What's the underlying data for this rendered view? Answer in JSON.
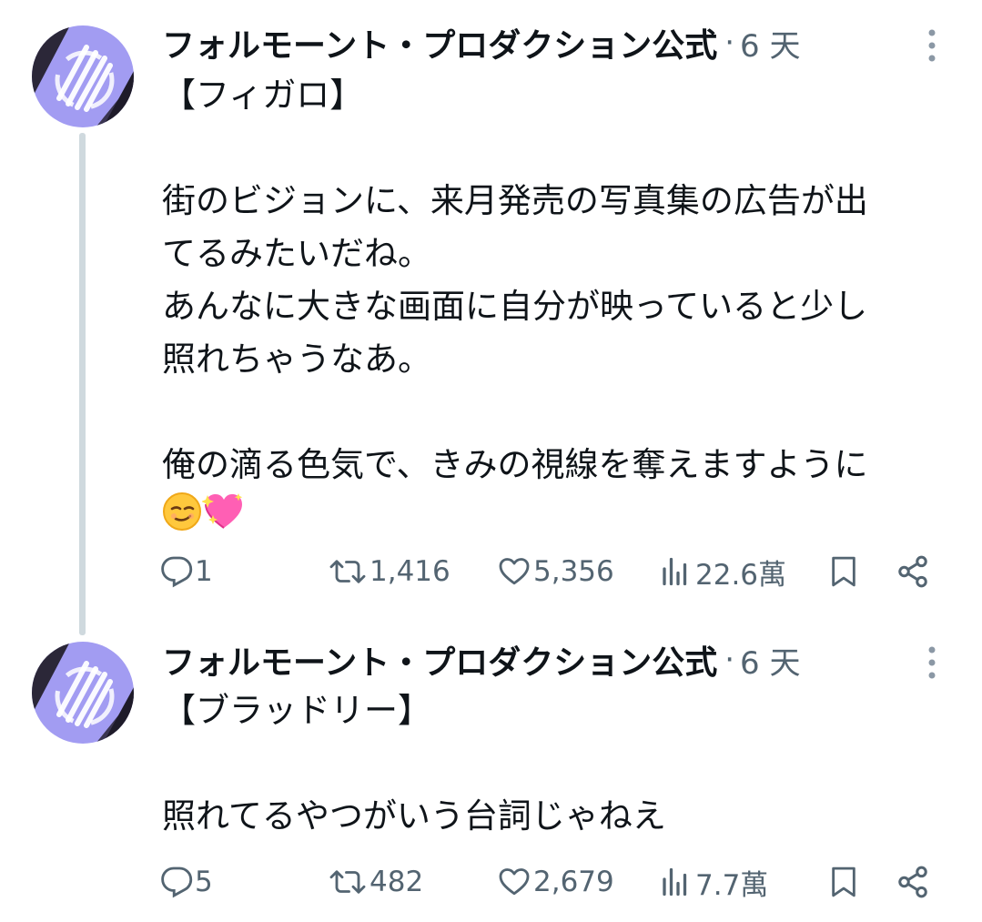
{
  "posts": [
    {
      "author": "フォルモーント・プロダクション公式",
      "separator": "·",
      "time": "6 天",
      "text": "【フィガロ】\n\n街のビジョンに、来月発売の写真集の広告が出\nてるみたいだね。\nあんなに大きな画面に自分が映っていると少し\n照れちゃうなあ。\n\n俺の滴る色気で、きみの視線を奪えますように\n",
      "emoji": [
        "smirking-face-emoji",
        "sparkling-heart-emoji"
      ],
      "replies": "1",
      "reposts": "1,416",
      "likes": "5,356",
      "views": "22.6萬"
    },
    {
      "author": "フォルモーント・プロダクション公式",
      "separator": "·",
      "time": "6 天",
      "text": "【ブラッドリー】\n\n照れてるやつがいう台詞じゃねえ",
      "replies": "5",
      "reposts": "482",
      "likes": "2,679",
      "views": "7.7萬"
    }
  ],
  "icons": {
    "reply": "speech-bubble-icon",
    "repost": "repost-arrows-icon",
    "like": "heart-icon",
    "views": "bar-chart-icon",
    "bookmark": "bookmark-icon",
    "share": "share-icon",
    "more": "more-vertical-icon"
  },
  "colors": {
    "text": "#0f1419",
    "secondary": "#536471",
    "thread_line": "#cfd9de",
    "avatar_purple": "#9d98f0",
    "avatar_dark": "#2b2738"
  }
}
